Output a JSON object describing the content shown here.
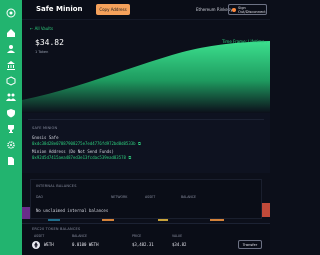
{
  "header": {
    "title": "Safe Minion",
    "copy_button": "Copy Address",
    "network": "Ethereum Rinkeby",
    "account_button": "Sign Out/Disconnect"
  },
  "sidebar": {
    "icons": [
      "logo-icon",
      "home-icon",
      "user-icon",
      "bank-icon",
      "cube-icon",
      "people-icon",
      "shield-icon",
      "trophy-icon",
      "gear-icon",
      "file-icon"
    ]
  },
  "vault": {
    "back_link": "← All Vaults",
    "balance": "$34.82",
    "balance_sub": "1 Token",
    "period": "Time Frame: Lifetime ▾"
  },
  "info": {
    "section_label": "SAFE MINION",
    "gnosis_label": "Gnosis Safe",
    "gnosis_address": "0xdc38d28e07887908275e7ed4776fd972bd8d8533b ⧉",
    "minion_label": "Minion Address (Do Not Send Funds)",
    "minion_address": "0x92d5d7415aea487ed3e13fcdac539ead83578 ⧉"
  },
  "internal": {
    "section_label": "INTERNAL BALANCES",
    "columns": [
      "DAO",
      "NETWORK",
      "ASSET",
      "BALANCE"
    ],
    "empty": "No unclaimed internal balances"
  },
  "erc": {
    "section_label": "ERC20 TOKEN BALANCES",
    "columns": [
      "ASSET",
      "BALANCE",
      "PRICE",
      "VALUE"
    ],
    "rows": [
      {
        "asset": "WETH",
        "balance": "0.0100 WETH",
        "price": "$3,482.31",
        "value": "$34.82",
        "action": "Transfer"
      }
    ]
  },
  "colors": {
    "accent": "#22b46f",
    "highlight": "#2ed17f",
    "button": "#f5a15b",
    "background": "#0c0f1a"
  }
}
